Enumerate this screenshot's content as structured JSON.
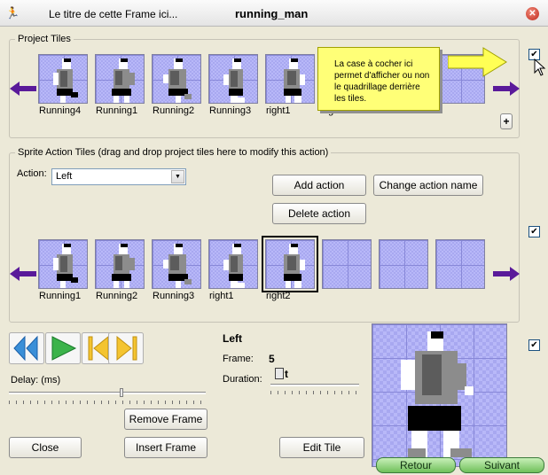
{
  "window": {
    "subtitle": "Le titre de cette Frame ici...",
    "title": "running_man",
    "close_glyph": "✕"
  },
  "project_tiles": {
    "label": "Project Tiles",
    "tiles": [
      "Running4",
      "Running1",
      "Running2",
      "Running3",
      "right1",
      "right2",
      "",
      ""
    ],
    "tooltip": "La case à cocher ici permet d'afficher ou non le quadrillage derrière les tiles.",
    "add_label": "+",
    "checkbox_checked": true
  },
  "action_tiles": {
    "label": "Sprite Action Tiles (drag and drop project tiles here to modify this action)",
    "action_label": "Action:",
    "action_value": "Left",
    "buttons": {
      "add": "Add action",
      "rename": "Change action name",
      "delete": "Delete action"
    },
    "tiles": [
      "Running1",
      "Running2",
      "Running3",
      "right1",
      "right2",
      "",
      "",
      ""
    ],
    "selected_index": 4,
    "checkbox_checked": true
  },
  "playback": {
    "delay_label": "Delay: (ms)",
    "delay_value": 0.57,
    "remove_frame": "Remove Frame",
    "insert_frame": "Insert Frame",
    "close": "Close",
    "edit_tile": "Edit Tile"
  },
  "frame_info": {
    "action_name": "Left",
    "frame_label": "Frame:",
    "frame_value": "5",
    "duration_label": "Duration:",
    "duration_glyph": "t",
    "duration_value": 0.05
  },
  "preview": {
    "checkbox_checked": true
  },
  "wizard": {
    "back": "Retour",
    "next": "Suivant"
  },
  "icons": {
    "title": "running-man-icon",
    "left_arrow": "left-arrow-icon",
    "right_arrow": "right-arrow-icon",
    "rewind": "rewind-icon",
    "play": "play-icon",
    "first_frame": "first-frame-icon",
    "last_frame": "last-frame-icon"
  },
  "colors": {
    "accent_arrow": "#5a1a9a",
    "tooltip_bg": "#ffff77",
    "play_green": "#3bb34a",
    "frame_yellow": "#f4c430",
    "wizard_green": "#6fbf5a"
  }
}
